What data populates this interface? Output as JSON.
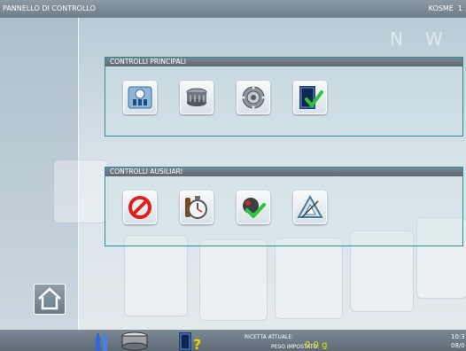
{
  "window": {
    "title": "PANNELLO DI CONTROLLO",
    "brand": "KOSME",
    "brand_suffix": "1"
  },
  "watermark": [
    "N",
    "W"
  ],
  "panels": {
    "main": {
      "title": "CONTROLLI PRINCIPALI",
      "buttons": [
        {
          "icon": "bottle-valves-icon"
        },
        {
          "icon": "rotary-filler-icon"
        },
        {
          "icon": "carousel-machine-icon"
        },
        {
          "icon": "checked-door-icon"
        }
      ]
    },
    "aux": {
      "title": "CONTROLLI AUSILIARI",
      "buttons": [
        {
          "icon": "prohibited-icon"
        },
        {
          "icon": "stopwatch-icon"
        },
        {
          "icon": "ball-check-icon"
        },
        {
          "icon": "triangle-drafting-icon"
        }
      ]
    }
  },
  "footer": {
    "recipe_label": "RICETTA ATTUALE:",
    "setpoint_label": "PESO IMPOSTATO:",
    "setpoint_value": "0,0 g",
    "time": "10:3",
    "date": "08/0"
  }
}
